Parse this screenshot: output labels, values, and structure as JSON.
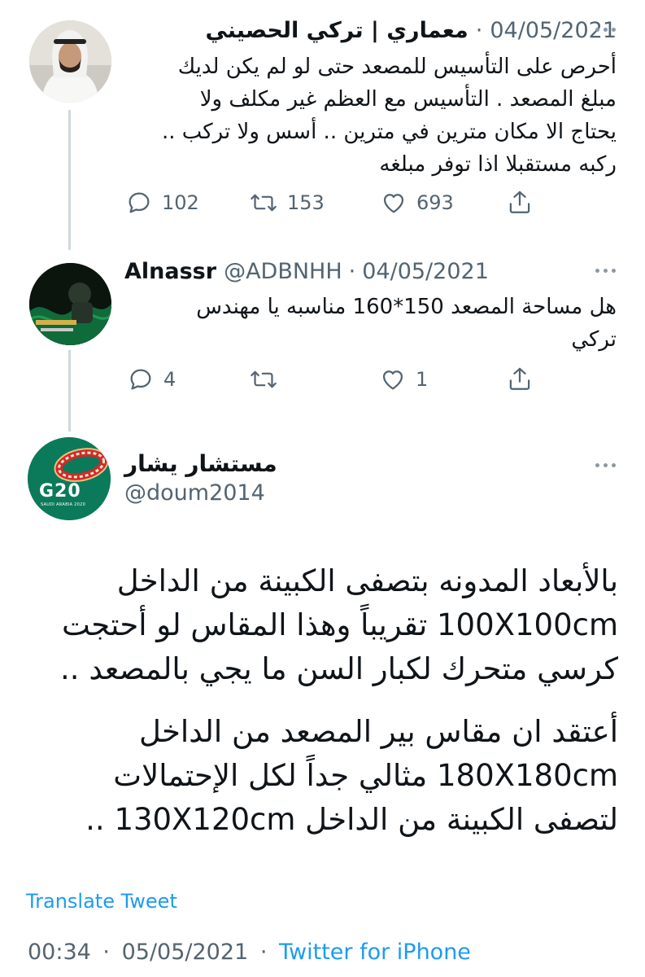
{
  "tweets": [
    {
      "display_name": "معماري | تركي الحصيني",
      "date": "04/05/2021",
      "text_lines": [
        "أحرص على التأسيس للمصعد حتى لو لم يكن لديك",
        "مبلغ المصعد . التأسيس مع العظم غير مكلف ولا",
        "يحتاج الا مكان مترين في مترين .. أسس ولا تركب ..",
        "ركبه مستقبلا اذا توفر مبلغه"
      ],
      "replies": "102",
      "retweets": "153",
      "likes": "693"
    },
    {
      "display_name": "Alnassr",
      "handle": "@ADBNHH",
      "date": "04/05/2021",
      "text_lines": [
        "هل مساحة المصعد 150*160 مناسبه يا مهندس",
        "تركي"
      ],
      "replies": "4",
      "retweets": "",
      "likes": "1"
    }
  ],
  "main_tweet": {
    "display_name": "مستشار يشار",
    "handle": "@doum2014",
    "avatar_text": "G20",
    "avatar_subtext": "SAUDI ARABIA 2020",
    "paragraph1": [
      "بالأبعاد المدونه بتصفى الكبينة من الداخل",
      "100X100cm تقريباً وهذا المقاس لو أحتجت",
      "كرسي متحرك لكبار السن ما يجي بالمصعد .."
    ],
    "paragraph2": [
      "أعتقد ان مقاس بير المصعد من الداخل",
      "180X180cm مثالي جداً لكل الإحتمالات",
      "لتصفى الكبينة من الداخل 130X120cm .."
    ],
    "translate_label": "Translate Tweet",
    "time": "00:34",
    "date": "05/05/2021",
    "source": "Twitter for iPhone"
  },
  "separator": "·",
  "icons": {
    "reply": "reply-icon",
    "retweet": "retweet-icon",
    "like": "heart-icon",
    "share": "share-icon",
    "more": "more-icon"
  },
  "colors": {
    "accent": "#1d9bf0",
    "secondary_text": "#536471",
    "thread_line": "#cfd9de",
    "g20_green": "#0b7a5a"
  }
}
